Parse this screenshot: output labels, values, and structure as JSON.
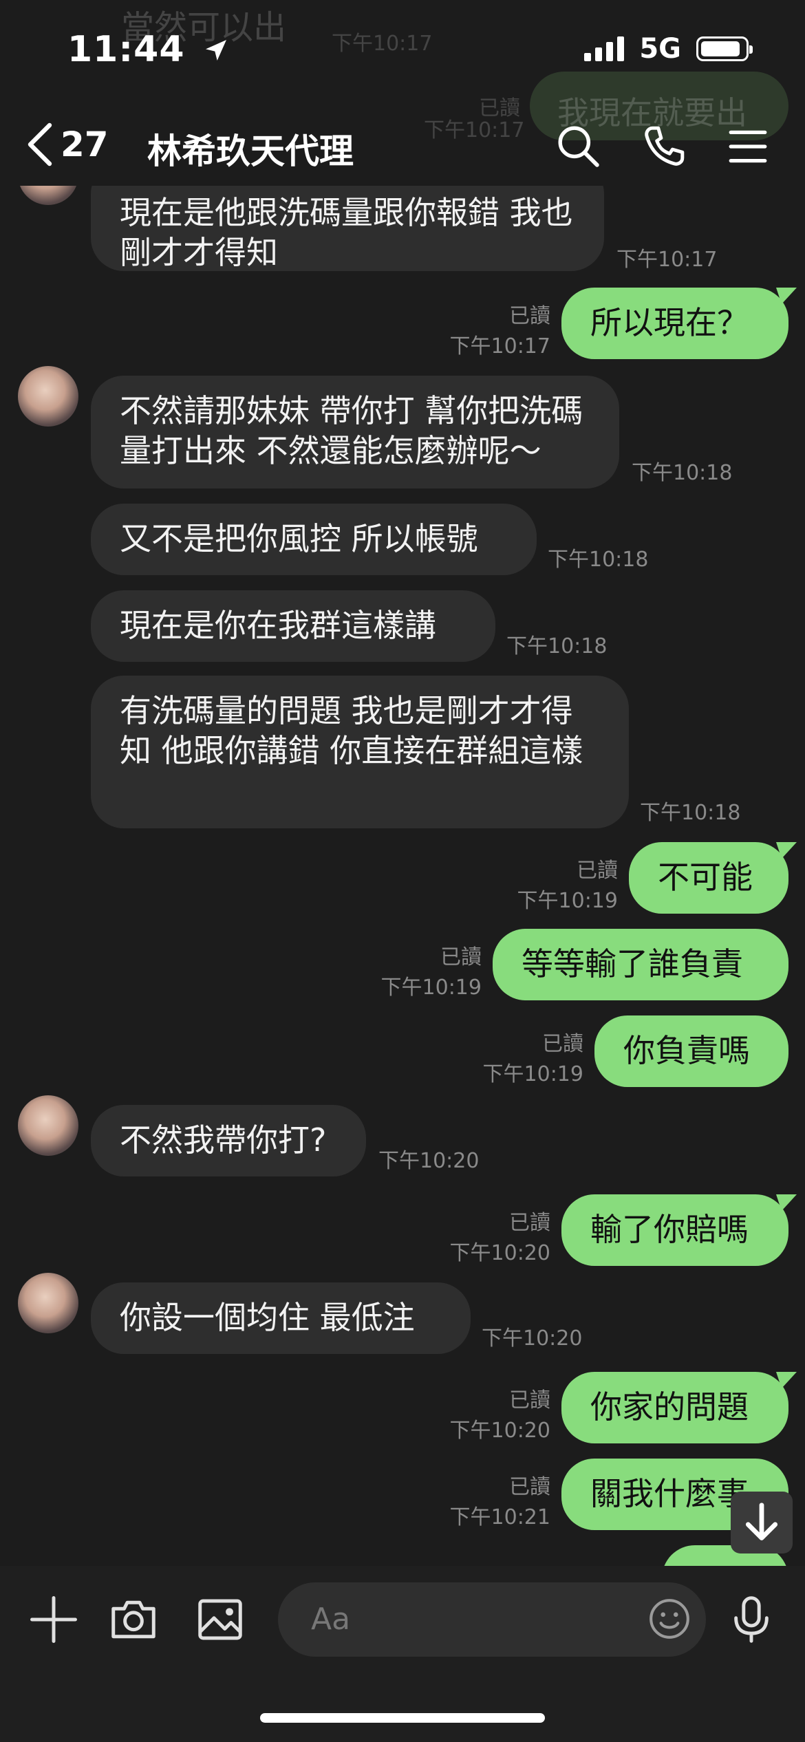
{
  "status_bar": {
    "time": "11:44",
    "network": "5G"
  },
  "ghost": {
    "top_text": "當然可以出",
    "top_time": "下午10:17",
    "right_text": "我現在就要出",
    "right_read": "已讀",
    "right_time": "下午10:17"
  },
  "header": {
    "unread_count": "27",
    "title": "林希玖天代理"
  },
  "messages": [
    {
      "dir": "in",
      "text": "現在是他跟洗碼量跟你報錯  我也剛才才得知",
      "time": "下午10:17"
    },
    {
      "dir": "out",
      "text": "所以現在？",
      "read": "已讀",
      "time": "下午10:17"
    },
    {
      "dir": "in",
      "text": "不然請那妹妹 帶你打 幫你把洗碼量打出來 不然還能怎麼辦呢～",
      "time": "下午10:18"
    },
    {
      "dir": "in",
      "text": "又不是把你風控  所以帳號",
      "time": "下午10:18"
    },
    {
      "dir": "in",
      "text": "現在是你在我群這樣講",
      "time": "下午10:18"
    },
    {
      "dir": "in",
      "text": "有洗碼量的問題 我也是剛才才得知 他跟你講錯 你直接在群組這樣",
      "time": "下午10:18"
    },
    {
      "dir": "out",
      "text": "不可能",
      "read": "已讀",
      "time": "下午10:19"
    },
    {
      "dir": "out",
      "text": "等等輸了誰負責",
      "read": "已讀",
      "time": "下午10:19"
    },
    {
      "dir": "out",
      "text": "你負責嗎",
      "read": "已讀",
      "time": "下午10:19"
    },
    {
      "dir": "in",
      "text": "不然我帶你打?",
      "time": "下午10:20"
    },
    {
      "dir": "out",
      "text": "輸了你賠嗎",
      "read": "已讀",
      "time": "下午10:20"
    },
    {
      "dir": "in",
      "text": "你設一個均住  最低注",
      "time": "下午10:20"
    },
    {
      "dir": "out",
      "text": "你家的問題",
      "read": "已讀",
      "time": "下午10:20"
    },
    {
      "dir": "out",
      "text": "關我什麼事",
      "read": "已讀",
      "time": "下午10:21"
    }
  ],
  "input": {
    "placeholder": "Aa"
  },
  "icons": {
    "back": "chevron-left-icon",
    "search": "search-icon",
    "call": "phone-icon",
    "menu": "menu-icon",
    "plus": "plus-icon",
    "camera": "camera-icon",
    "image": "image-icon",
    "emoji": "emoji-icon",
    "mic": "microphone-icon",
    "scroll": "arrow-down-icon"
  },
  "colors": {
    "outgoing_bubble": "#88dc7d",
    "incoming_bubble": "#2e2e2e",
    "background": "#1c1c1c"
  }
}
